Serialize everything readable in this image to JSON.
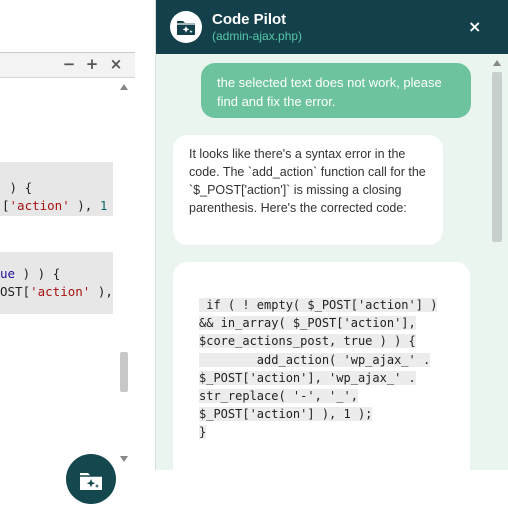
{
  "editor": {
    "controls": {
      "minimize": "−",
      "maximize": "+",
      "close": "×"
    },
    "lines": [
      {
        "parts": [
          {
            "t": " ) {",
            "c": ""
          }
        ]
      },
      {
        "parts": [
          {
            "t": "[",
            "c": ""
          },
          {
            "t": "'action'",
            "c": "str"
          },
          {
            "t": " ), ",
            "c": ""
          },
          {
            "t": "1",
            "c": "num"
          }
        ]
      },
      {
        "parts": [
          {
            "t": "ue",
            "c": "kw"
          },
          {
            "t": " ) ) {",
            "c": ""
          }
        ]
      },
      {
        "parts": [
          {
            "t": "OST[",
            "c": ""
          },
          {
            "t": "'action'",
            "c": "str"
          },
          {
            "t": " ),",
            "c": ""
          }
        ]
      }
    ]
  },
  "chat": {
    "title": "Code Pilot",
    "subtitle": "(admin-ajax.php)",
    "close_label": "×",
    "user_message": "the selected text does not work, please find and fix the error.",
    "assistant_message": "It looks like there's a syntax error in the code. The `add_action` function call for the `$_POST['action']` is missing a closing parenthesis. Here's the corrected code:",
    "code_lines": [
      " if ( ! empty( $_POST['action'] )",
      "&& in_array( $_POST['action'],",
      "$core_actions_post, true ) ) {",
      "        add_action( 'wp_ajax_' .",
      "$_POST['action'], 'wp_ajax_' .",
      "str_replace( '-', '_',",
      "$_POST['action'] ), 1 );",
      "}"
    ]
  },
  "colors": {
    "header_bg": "#13404b",
    "accent": "#6cc39e",
    "subtitle": "#58c7a5",
    "panel_bg": "#eaf5ef"
  },
  "icons": {
    "logo": "sparkle-folder-icon",
    "fab": "sparkle-folder-icon"
  }
}
